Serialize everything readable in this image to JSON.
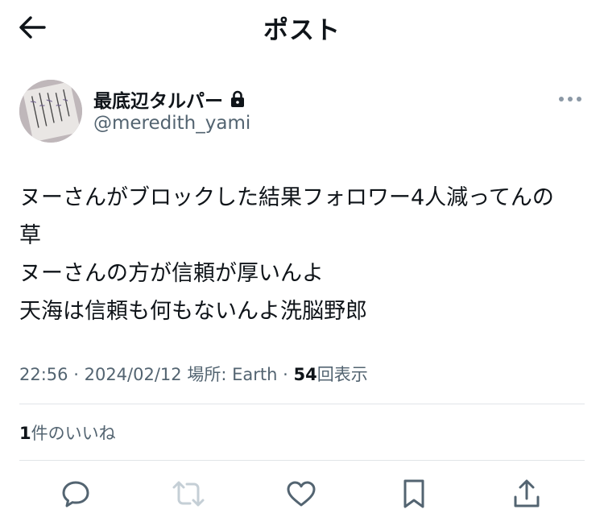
{
  "header": {
    "title": "ポスト",
    "back_icon": "arrow-left-icon"
  },
  "author": {
    "display_name": "最底辺タルパー",
    "handle": "@meredith_yami",
    "protected_icon": "lock-icon",
    "avatar_icon": "avatar-image"
  },
  "tweet": {
    "text": "ヌーさんがブロックした結果フォロワー4人減ってんの\n草\nヌーさんの方が信頼が厚いんよ\n天海は信頼も何もないんよ洗脳野郎"
  },
  "meta": {
    "time": "22:56",
    "date": "2024/02/12",
    "location_label": "場所: Earth",
    "view_count": "54",
    "view_label": "回表示",
    "separator": "·"
  },
  "engagement": {
    "like_count": "1",
    "like_label": "件のいいね"
  },
  "actions": {
    "icons": [
      "reply-icon",
      "retweet-icon",
      "like-icon",
      "bookmark-icon",
      "share-icon"
    ],
    "retweet_disabled_color": "#c5cfd6",
    "icon_color": "#536471"
  }
}
